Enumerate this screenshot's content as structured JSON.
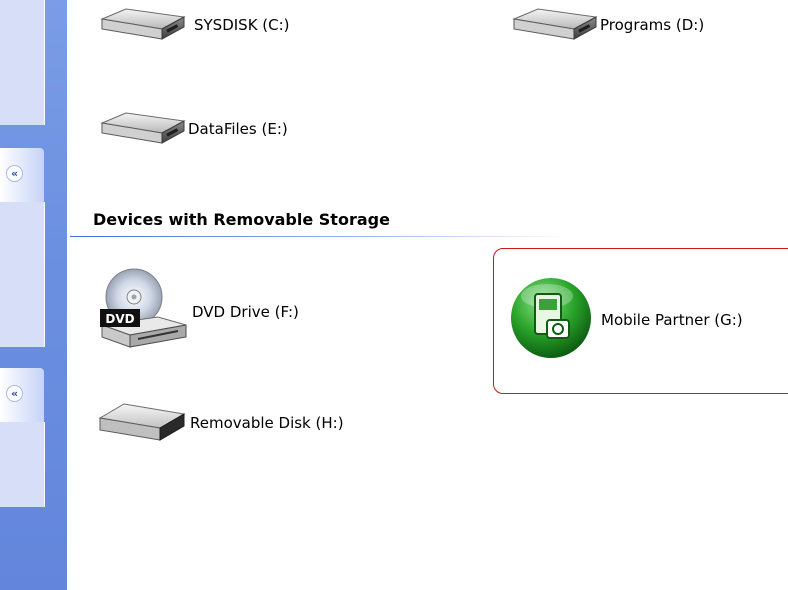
{
  "taskpane": {
    "collapse_glyph": "«"
  },
  "hard_disks": [
    {
      "label": "SYSDISK (C:)",
      "icon": "hard-disk-icon"
    },
    {
      "label": "Programs (D:)",
      "icon": "hard-disk-icon"
    },
    {
      "label": "DataFiles (E:)",
      "icon": "hard-disk-icon"
    }
  ],
  "removable": {
    "title": "Devices with Removable Storage",
    "items": [
      {
        "label": "DVD Drive (F:)",
        "icon": "dvd-drive-icon",
        "badge": "DVD"
      },
      {
        "label": "Mobile Partner (G:)",
        "icon": "mobile-partner-icon"
      },
      {
        "label": "Removable Disk (H:)",
        "icon": "removable-disk-icon"
      }
    ]
  },
  "colors": {
    "selection_border": "#c41a1a",
    "taskpane_blue": "#6b8fe0",
    "mobile_green": "#2aa52a"
  }
}
